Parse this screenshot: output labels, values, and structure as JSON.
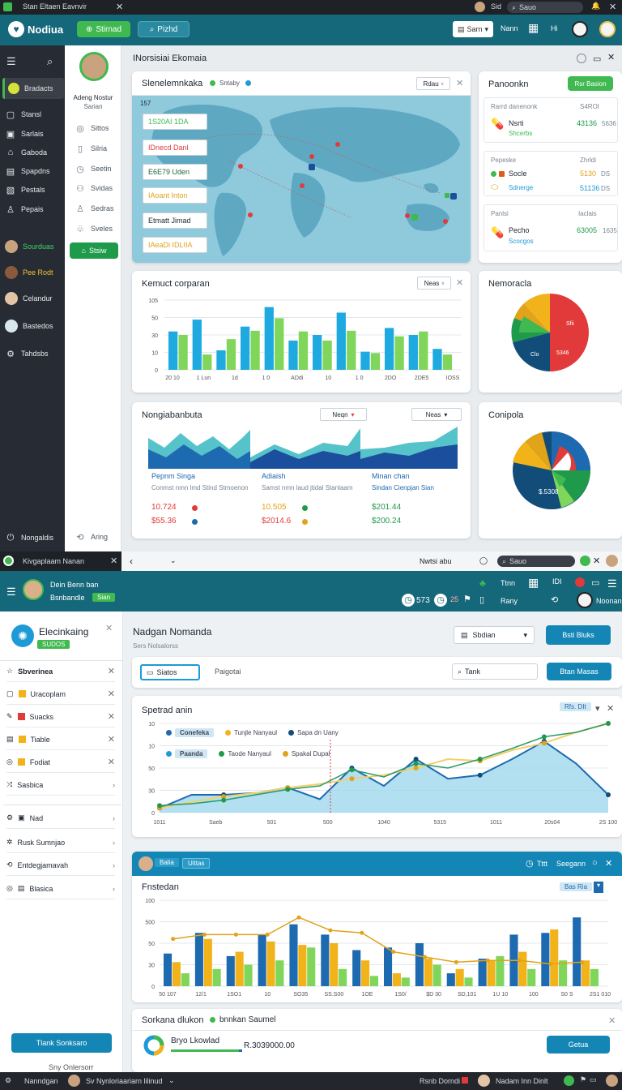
{
  "top": {
    "title": "Stan Eltaen Eavnvir",
    "user_short": "Sid",
    "search_placeholder": "Sauo"
  },
  "app": {
    "brand": "Nodiua",
    "primary_btn": "Stirnad",
    "secondary_btn": "Pizhd",
    "header_select": "Sarn",
    "header_item1": "Nann",
    "header_item2": "Hi"
  },
  "sidebar1": {
    "active": "Bradacts",
    "items": [
      {
        "label": "Stansl",
        "icon": "square-icon"
      },
      {
        "label": "Sarlais",
        "icon": "box-icon"
      },
      {
        "label": "Gaboda",
        "icon": "shop-icon"
      },
      {
        "label": "Spapdns",
        "icon": "list-icon"
      },
      {
        "label": "Pestals",
        "icon": "doc-icon"
      },
      {
        "label": "Pepais",
        "icon": "user-icon"
      }
    ],
    "people": [
      {
        "label": "Sourduas",
        "color": "#3ed66b"
      },
      {
        "label": "Pee Rodt",
        "color": "#f2c230"
      },
      {
        "label": "Celandur",
        "color": "#e8ecef"
      },
      {
        "label": "Bastedos",
        "color": "#e8ecef"
      }
    ],
    "settings": "Tahdsbs",
    "footer": "Nongaldis"
  },
  "subnav1": {
    "profile_name": "Adeng Nostur",
    "profile_sub": "Sarian",
    "items": [
      "Sittos",
      "Silria",
      "Seetin",
      "Svidas",
      "Sedras",
      "Sveles"
    ],
    "active": "Stsiw",
    "footer": "Aring"
  },
  "main1": {
    "title": "INorsisiai Ekomaia",
    "map_panel": {
      "title": "Slenelemnkaka",
      "legend": "Sntaby",
      "control": "Rdau",
      "tags": [
        "1S20AI 1DA",
        "IDnecd Danl",
        "E6E79 Uden",
        "IAoant Inton",
        "Etmatt Jimad",
        "IAeaDi IDLIIA"
      ],
      "count": "157"
    },
    "right_panel": {
      "title": "Panoonkn",
      "button": "Rsr Basion",
      "groups": [
        {
          "title": "Rarrd danenonk",
          "tag": "S4ROI",
          "name": "Nsrti",
          "sub": "Shcerbs",
          "value": "43136",
          "value2": "5636"
        },
        {
          "title": "Pepeske",
          "tag": "Zhrldi",
          "name": "Socle",
          "sub": "Sdnerge",
          "value": "5130",
          "value2": "DS",
          "value3": "51136",
          "value4": "DS"
        },
        {
          "title": "Panlsi",
          "tag": "Iaclais",
          "name": "Pecho",
          "sub": "Scocgos",
          "value": "63005",
          "value2": "1635"
        }
      ]
    },
    "bar_panel": {
      "title": "Kemuct corparan",
      "control": "Neas",
      "yticks": [
        "105",
        "50",
        "30",
        "10",
        "0"
      ],
      "xticks": [
        "20 10",
        "1 Lun",
        "1d",
        "1 0",
        "ADdi",
        "10",
        "1 0",
        "2DO",
        "2DE5",
        "IOSS"
      ]
    },
    "pie_panel1": {
      "title": "Nemoracla",
      "label1": "Sfii",
      "label2": "Clo",
      "label3": "5346"
    },
    "area_panel": {
      "title": "Nongiabanbuta",
      "control1": "Neqn",
      "control2": "Neas",
      "cols": [
        {
          "title": "Pepnm Singa",
          "desc": "Conmst nmn lmd Stind Stmoenon",
          "v1": "10.724",
          "v2": "$55.36"
        },
        {
          "title": "Adiaish",
          "desc": "Samst nmn laud jtidal Stanlaam",
          "v1": "10.505",
          "v2": "$2014.6"
        },
        {
          "title": "Minan chan",
          "desc": "Sindan Cienpjan Sian",
          "v1": "$201.44",
          "v2": "$200.24"
        }
      ]
    },
    "pie_panel2": {
      "title": "Conipola",
      "label": "$.5308"
    }
  },
  "win2": {
    "top_title": "Kivgaplaam Nanan",
    "top_search": "Sauo",
    "profile_name": "Dein Benn ban",
    "profile_sub": "Bsnbandle",
    "badge": "Sian",
    "header_count": "573",
    "header_item": "Ttnn",
    "header_item2": "Rany",
    "header_user": "Noonan",
    "left": {
      "title": "Elecinkaing",
      "badge": "SUDOS",
      "list": [
        {
          "label": "Sbverinea",
          "icon": "star-icon",
          "color": ""
        },
        {
          "label": "Uracoplam",
          "icon": "square-icon",
          "color": "#f2b31a"
        },
        {
          "label": "Suacks",
          "icon": "pen-icon",
          "color": "#e23a3a"
        },
        {
          "label": "Tiable",
          "icon": "doc-icon",
          "color": "#f2b31a"
        },
        {
          "label": "Fodiat",
          "icon": "target-icon",
          "color": "#f2b31a"
        },
        {
          "label": "Sasbica",
          "icon": "shuffle-icon",
          "color": ""
        }
      ],
      "list2": [
        {
          "label": "Nad",
          "icon": "gear-icon"
        },
        {
          "label": "Rusk Sumnjao",
          "icon": "gear-icon"
        },
        {
          "label": "Entdegjamavah",
          "icon": "refresh-icon"
        },
        {
          "label": "Blasica",
          "icon": "doc-icon"
        }
      ],
      "action": "Tlank  Sonksaro",
      "footer": "Sny Onlersorr"
    },
    "page_title": "Nadgan Nomanda",
    "page_sub": "Sers Nolsalorss",
    "select_label": "Sbdian",
    "top_button": "Bsti Bluks",
    "filter_input": "Siatos",
    "filter_text": "Paigotai",
    "filter_search": "Tank",
    "filter_button": "Btan Masas",
    "line_panel": {
      "title": "Spetrad anin",
      "chip": "Rfs. DIt",
      "legend1": [
        "Conefeka",
        "Tunjle Nanyaul",
        "Sapa dn Uany"
      ],
      "legend2": [
        "Paanda",
        "Taode Nanyaul",
        "Spakal Dupal"
      ],
      "yticks": [
        "10",
        "10",
        "50",
        "30",
        "0"
      ],
      "xticks": [
        "1011",
        "Saeb",
        "501",
        "500",
        "1040",
        "5315",
        "1011",
        "20s04",
        "2S 100"
      ]
    },
    "bar2_panel": {
      "header_left": "Balia",
      "header_tab": "Uittas",
      "header_right1": "Tttt",
      "header_right2": "Seegann",
      "title": "Fnstedan",
      "chip": "Bas Ria",
      "yticks": [
        "100",
        "500",
        "50",
        "30",
        "0"
      ],
      "xticks": [
        "50 107",
        "12/1",
        "1SO1",
        "10",
        "SO35",
        "SS.S00",
        "1OE",
        "1S0/",
        "$D 30",
        "SD,101",
        "1U 10",
        "100",
        "S0 S",
        "2S1 010"
      ]
    },
    "summary": {
      "title": "Sorkana dlukon",
      "legend": "bnnkan Saumel",
      "name": "Bryo Lkowlad",
      "amount": "R.3039000.00",
      "button": "Getua"
    }
  },
  "taskbar": {
    "left": "Nanndgan",
    "middle": "Sv Nynloriaariarn lilinud",
    "right_label": "Rsnb Dorndi",
    "user": "Nadam Inn Dinlt"
  }
}
